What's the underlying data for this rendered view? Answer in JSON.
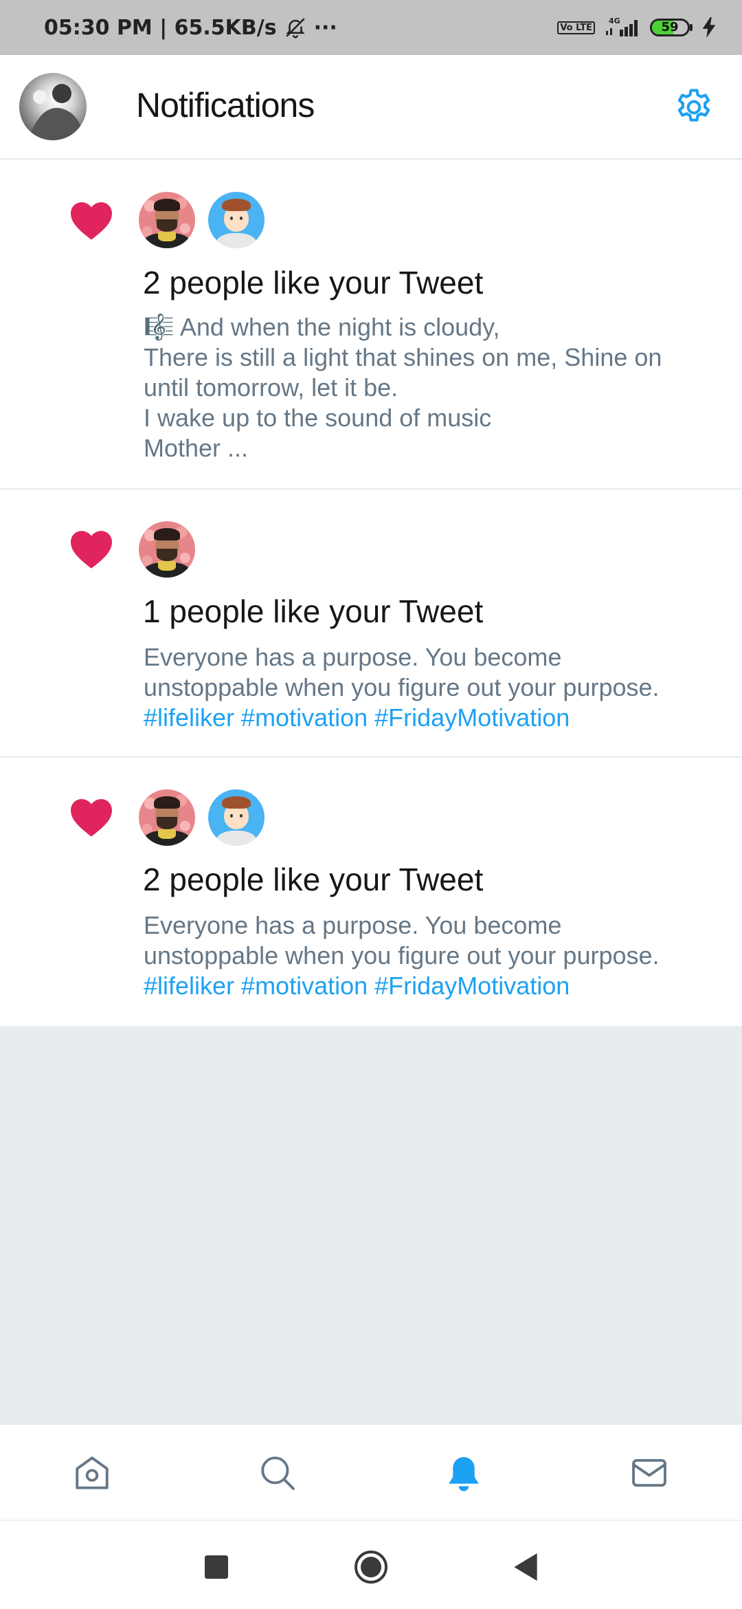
{
  "status_bar": {
    "time_speed": "05:30 PM | 65.5KB/s",
    "more": "···",
    "volte": "Vo LTE",
    "network": "4G",
    "battery_level": 59,
    "battery_text": "59"
  },
  "header": {
    "title": "Notifications"
  },
  "notifications": [
    {
      "title": "2 people like your Tweet",
      "body_lines": [
        "🎼 And when the night is cloudy,",
        "There is still a light that shines on me, Shine on",
        "until tomorrow, let it be.",
        "I wake up to the sound of music",
        "Mother ..."
      ]
    },
    {
      "title": "1 people like your Tweet",
      "body_lines": [
        "Everyone has a purpose. You become",
        "unstoppable when you figure out your purpose."
      ],
      "hashtags": "#lifeliker #motivation #FridayMotivation"
    },
    {
      "title": "2 people like your Tweet",
      "body_lines": [
        "Everyone has a purpose. You become",
        "unstoppable when you figure out your purpose."
      ],
      "hashtags": "#lifeliker #motivation #FridayMotivation"
    }
  ],
  "bottom_nav": {
    "active": "notifications",
    "items": [
      "home-icon",
      "search-icon",
      "notifications-icon",
      "messages-icon"
    ],
    "active_color": "#1da1f2",
    "inactive_color": "#657786"
  },
  "colors": {
    "heart": "#e0245e",
    "link": "#1da1f2",
    "body_text": "#657786",
    "background": "#e6ecf0"
  }
}
